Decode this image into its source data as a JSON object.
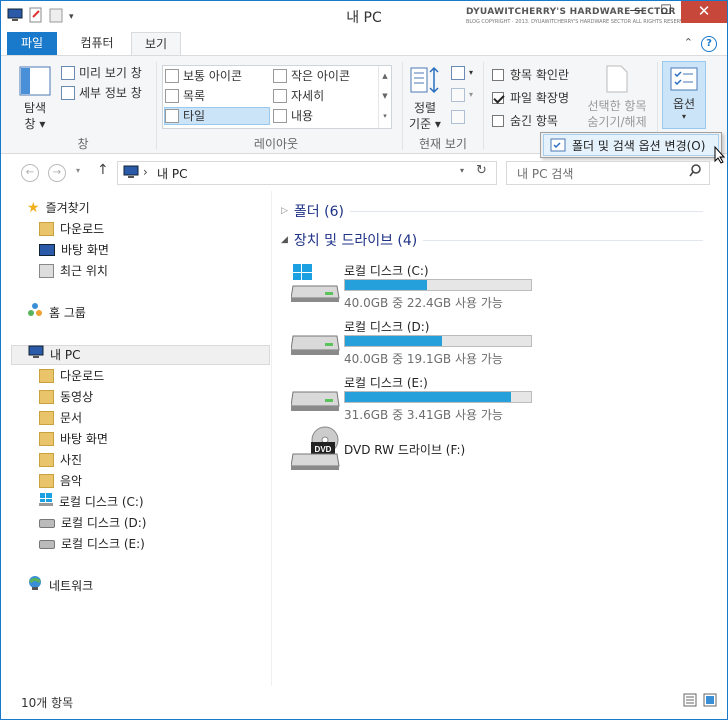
{
  "window": {
    "title": "내 PC",
    "watermark_line1": "DYUAWITCHERRY'S HARDWARE SECTOR",
    "watermark_line2": "BLOG COPYRIGHT · 2013. DYUAWITCHERRY'S HARDWARE SECTOR ALL RIGHTS RESERVED",
    "minimize": "—",
    "maximize": "☐",
    "close": "✕"
  },
  "ribbon_tabs": {
    "file": "파일",
    "computer": "컴퓨터",
    "view": "보기"
  },
  "ribbon": {
    "panes": {
      "nav_pane_line1": "탐색",
      "nav_pane_line2": "창 ▾",
      "preview_pane": "미리 보기 창",
      "details_pane": "세부 정보 창",
      "group_label": "창"
    },
    "layout": {
      "items": [
        "보통 아이콘",
        "작은 아이콘",
        "목록",
        "자세히",
        "타일",
        "내용"
      ],
      "selected": "타일",
      "group_label": "레이아웃"
    },
    "current_view": {
      "sort_line1": "정렬",
      "sort_line2": "기준 ▾",
      "group_label": "현재 보기"
    },
    "show_hide": {
      "item_checkboxes": "항목 확인란",
      "item_checkboxes_checked": false,
      "file_extensions": "파일 확장명",
      "file_extensions_checked": true,
      "hidden_items": "숨긴 항목",
      "hidden_items_checked": false,
      "hide_selected_line1": "선택한 항목",
      "hide_selected_line2": "숨기기/해제"
    },
    "options": {
      "label": "옵션",
      "arrow": "▾"
    }
  },
  "options_menu": {
    "item": "폴더 및 검색 옵션 변경(O)"
  },
  "address_bar": {
    "path": "내 PC",
    "separator": "›",
    "search_placeholder": "내 PC 검색"
  },
  "nav_pane": {
    "favorites": "즐겨찾기",
    "fav_items": [
      "다운로드",
      "바탕 화면",
      "최근 위치"
    ],
    "homegroup": "홈 그룹",
    "this_pc": "내 PC",
    "pc_items": [
      "다운로드",
      "동영상",
      "문서",
      "바탕 화면",
      "사진",
      "음악",
      "로컬 디스크 (C:)",
      "로컬 디스크 (D:)",
      "로컬 디스크 (E:)"
    ],
    "network": "네트워크"
  },
  "content": {
    "folders_header": "폴더 (6)",
    "devices_header": "장치 및 드라이브 (4)",
    "drives": [
      {
        "name": "로컬 디스크 (C:)",
        "info": "40.0GB 중 22.4GB 사용 가능",
        "used_fraction": 0.44
      },
      {
        "name": "로컬 디스크 (D:)",
        "info": "40.0GB 중 19.1GB 사용 가능",
        "used_fraction": 0.52
      },
      {
        "name": "로컬 디스크 (E:)",
        "info": "31.6GB 중 3.41GB 사용 가능",
        "used_fraction": 0.89
      }
    ],
    "dvd": {
      "name": "DVD RW 드라이브 (F:)",
      "label": "DVD"
    }
  },
  "status_bar": {
    "count": "10개 항목"
  },
  "colors": {
    "accent": "#1979ca",
    "drive_bar": "#26a0da",
    "close_button": "#c7483a"
  }
}
